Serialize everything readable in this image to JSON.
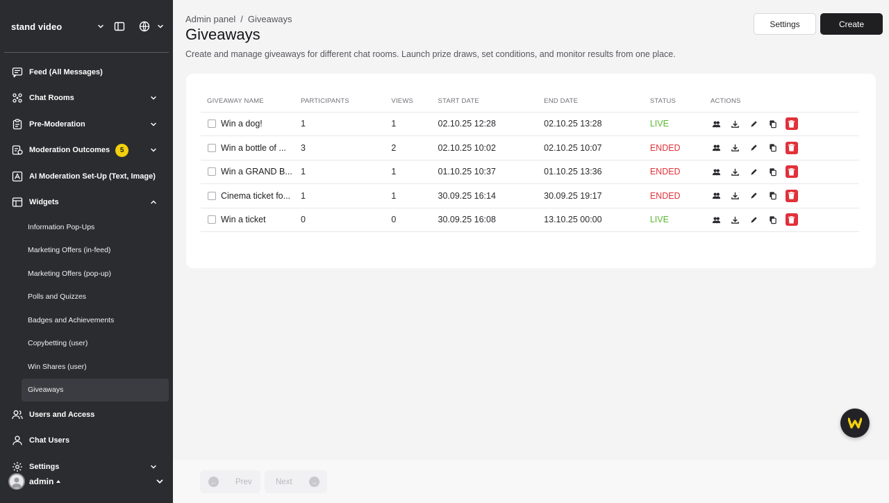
{
  "sidebar": {
    "brand": "stand video",
    "nav": [
      {
        "label": "Feed (All Messages)",
        "icon": "feed-icon",
        "chevron": false
      },
      {
        "label": "Chat Rooms",
        "icon": "chat-rooms-icon",
        "chevron": true
      },
      {
        "label": "Pre-Moderation",
        "icon": "clipboard-icon",
        "chevron": true
      },
      {
        "label": "Moderation Outcomes",
        "icon": "outcomes-icon",
        "chevron": true,
        "badge": "5"
      },
      {
        "label": "AI Moderation Set-Up (Text, Image)",
        "icon": "ai-icon",
        "chevron": false
      },
      {
        "label": "Widgets",
        "icon": "widgets-icon",
        "chevron": true,
        "expanded": true
      }
    ],
    "sub_items": [
      "Information Pop-Ups",
      "Marketing Offers (in-feed)",
      "Marketing Offers (pop-up)",
      "Polls and Quizzes",
      "Badges and Achievements",
      "Copybetting (user)",
      "Win Shares (user)",
      "Giveaways"
    ],
    "active_sub": "Giveaways",
    "nav_bottom": [
      {
        "label": "Users and Access",
        "icon": "users-icon"
      },
      {
        "label": "Chat Users",
        "icon": "user-icon"
      },
      {
        "label": "Settings",
        "icon": "gear-icon",
        "chevron": true
      }
    ],
    "user": {
      "name": "admin"
    }
  },
  "header": {
    "breadcrumb": [
      "Admin panel",
      "Giveaways"
    ],
    "breadcrumb_separator": "/",
    "title": "Giveaways",
    "description": "Create and manage giveaways for different chat rooms. Launch prize draws, set conditions, and monitor results from one place.",
    "settings_label": "Settings",
    "create_label": "Create"
  },
  "table": {
    "columns": [
      "GIVEAWAY NAME",
      "PARTICIPANTS",
      "VIEWS",
      "START DATE",
      "END DATE",
      "STATUS",
      "ACTIONS"
    ],
    "rows": [
      {
        "name": "Win a dog!",
        "participants": "1",
        "views": "1",
        "start": "02.10.25 12:28",
        "end": "02.10.25 13:28",
        "status": "LIVE"
      },
      {
        "name": "Win a bottle of ...",
        "participants": "3",
        "views": "2",
        "start": "02.10.25 10:02",
        "end": "02.10.25 10:07",
        "status": "ENDED"
      },
      {
        "name": "Win a GRAND B...",
        "participants": "1",
        "views": "1",
        "start": "01.10.25 10:37",
        "end": "01.10.25 13:36",
        "status": "ENDED"
      },
      {
        "name": "Cinema ticket fo...",
        "participants": "1",
        "views": "1",
        "start": "30.09.25 16:14",
        "end": "30.09.25 19:17",
        "status": "ENDED"
      },
      {
        "name": "Win a ticket",
        "participants": "0",
        "views": "0",
        "start": "30.09.25 16:08",
        "end": "13.10.25 00:00",
        "status": "LIVE"
      }
    ]
  },
  "pagination": {
    "prev_label": "Prev",
    "next_label": "Next"
  },
  "colors": {
    "live": "#58b832",
    "ended": "#e0313a",
    "sidebar_bg": "#2b2c30",
    "badge": "#f2d00d",
    "primary": "#1f1f22"
  }
}
